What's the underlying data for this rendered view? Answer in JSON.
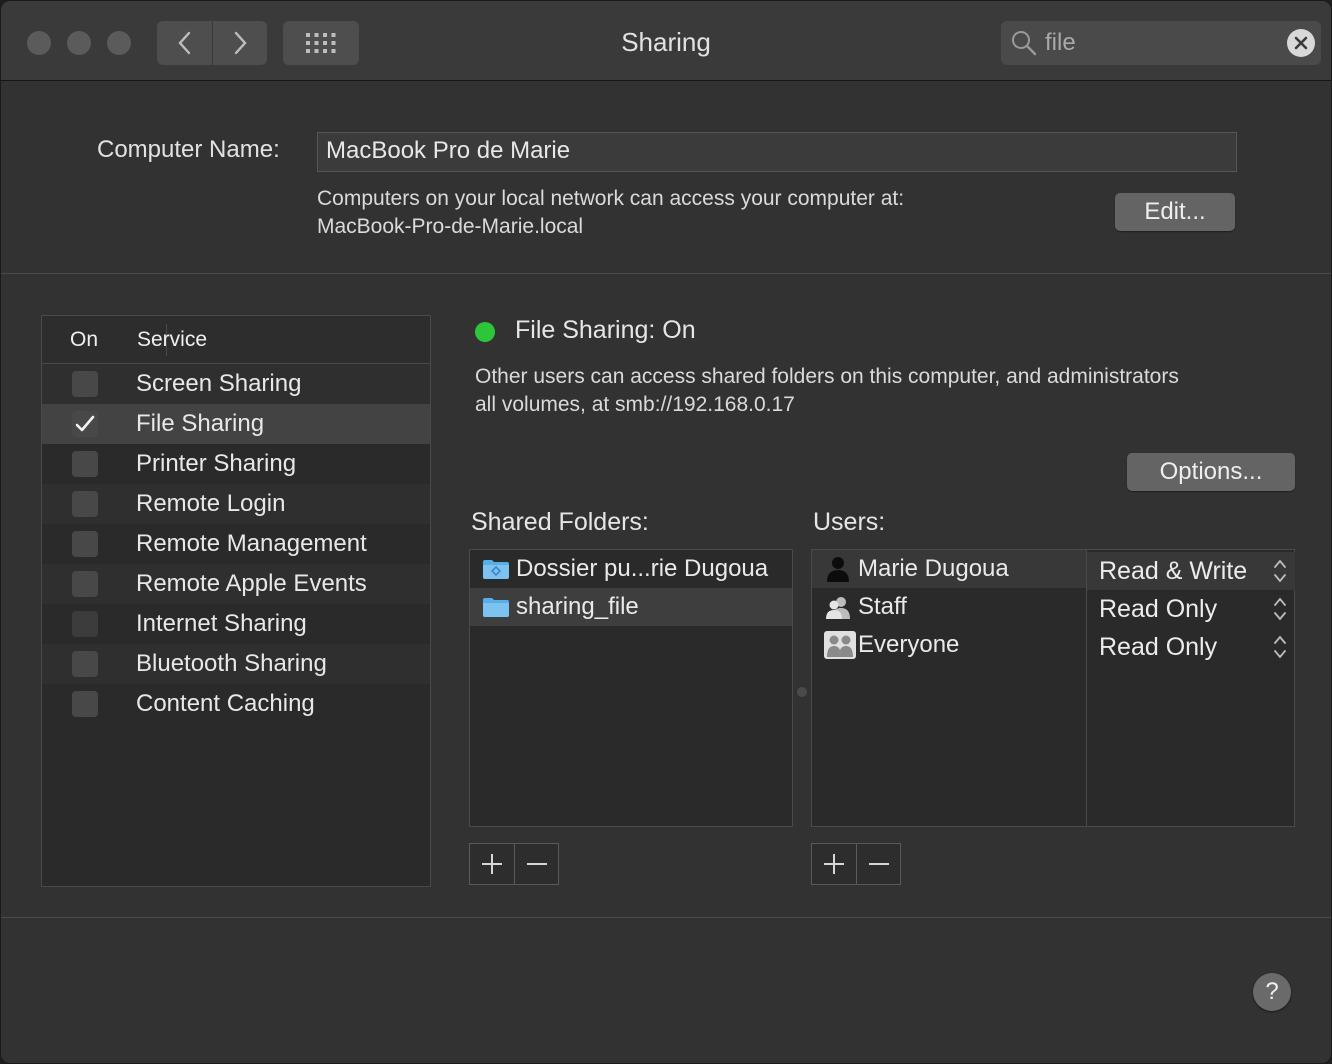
{
  "window": {
    "title": "Sharing"
  },
  "search": {
    "value": "file",
    "placeholder": "Search"
  },
  "computer_name": {
    "label": "Computer Name:",
    "value": "MacBook Pro de Marie",
    "info_line1": "Computers on your local network can access your computer at:",
    "info_line2": "MacBook-Pro-de-Marie.local",
    "edit_label": "Edit..."
  },
  "services": {
    "header_on": "On",
    "header_service": "Service",
    "items": [
      {
        "label": "Screen Sharing",
        "checked": false
      },
      {
        "label": "File Sharing",
        "checked": true,
        "selected": true
      },
      {
        "label": "Printer Sharing",
        "checked": false
      },
      {
        "label": "Remote Login",
        "checked": false
      },
      {
        "label": "Remote Management",
        "checked": false
      },
      {
        "label": "Remote Apple Events",
        "checked": false
      },
      {
        "label": "Internet Sharing",
        "checked": false
      },
      {
        "label": "Bluetooth Sharing",
        "checked": false
      },
      {
        "label": "Content Caching",
        "checked": false
      }
    ]
  },
  "status": {
    "text": "File Sharing: On",
    "color": "#2dc53a",
    "desc_line1": "Other users can access shared folders on this computer, and administrators",
    "desc_line2": "all volumes, at smb://192.168.0.17",
    "options_label": "Options..."
  },
  "shared_folders": {
    "label": "Shared Folders:",
    "items": [
      {
        "name": "Dossier pu...rie Dugoua",
        "icon": "public-folder-icon"
      },
      {
        "name": "sharing_file",
        "icon": "folder-icon",
        "selected": true
      }
    ]
  },
  "users": {
    "label": "Users:",
    "items": [
      {
        "name": "Marie Dugoua",
        "icon": "user-icon",
        "permission": "Read & Write",
        "selected": true
      },
      {
        "name": "Staff",
        "icon": "group-icon",
        "permission": "Read Only"
      },
      {
        "name": "Everyone",
        "icon": "everyone-icon",
        "permission": "Read Only"
      }
    ]
  },
  "buttons": {
    "add": "+",
    "remove": "−",
    "help": "?"
  }
}
